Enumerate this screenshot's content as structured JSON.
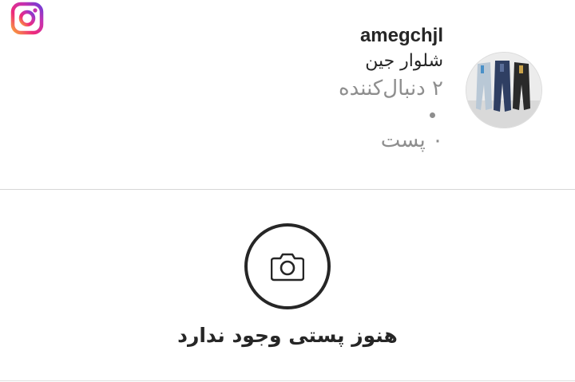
{
  "brand": {
    "logo_icon": "instagram-icon"
  },
  "profile": {
    "username": "amegchjl",
    "bio": "شلوار جین",
    "followers": "۲ دنبال‌کننده",
    "separator": "•",
    "posts": "۰ پست",
    "avatar_icon": "profile-photo-jeans"
  },
  "empty_state": {
    "icon": "camera-icon",
    "message": "هنوز پستی وجود ندارد"
  },
  "colors": {
    "text_primary": "#262626",
    "text_secondary": "#8e8e8e",
    "divider": "#d6d6d6"
  }
}
